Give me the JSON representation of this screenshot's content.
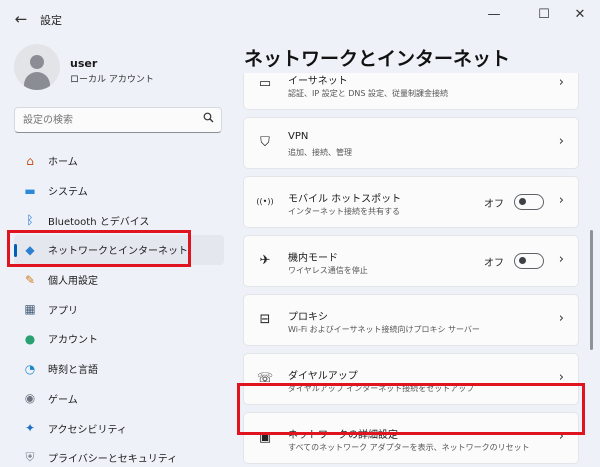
{
  "window": {
    "title": "設定",
    "back_glyph": "←",
    "minimize_glyph": "—",
    "maximize_glyph": "☐",
    "close_glyph": "✕"
  },
  "profile": {
    "name": "user",
    "account_type": "ローカル アカウント"
  },
  "search": {
    "placeholder": "設定の検索",
    "icon": "search-icon"
  },
  "sidebar": {
    "items": [
      {
        "label": "ホーム",
        "icon": "home-icon",
        "glyph": "⌂",
        "color": "#c2551d"
      },
      {
        "label": "システム",
        "icon": "system-icon",
        "glyph": "▬",
        "color": "#2e8ad8"
      },
      {
        "label": "Bluetooth とデバイス",
        "icon": "bluetooth-icon",
        "glyph": "ᛒ",
        "color": "#1d6fd6"
      },
      {
        "label": "ネットワークとインターネット",
        "icon": "wifi-icon",
        "glyph": "◆",
        "color": "#2d7fd2"
      },
      {
        "label": "個人用設定",
        "icon": "brush-icon",
        "glyph": "✎",
        "color": "#d0791e"
      },
      {
        "label": "アプリ",
        "icon": "apps-icon",
        "glyph": "▦",
        "color": "#4a6078"
      },
      {
        "label": "アカウント",
        "icon": "account-icon",
        "glyph": "●",
        "color": "#2aa171"
      },
      {
        "label": "時刻と言語",
        "icon": "globe-clock-icon",
        "glyph": "◔",
        "color": "#1f86c8"
      },
      {
        "label": "ゲーム",
        "icon": "gamepad-icon",
        "glyph": "◉",
        "color": "#6d7480"
      },
      {
        "label": "アクセシビリティ",
        "icon": "accessibility-icon",
        "glyph": "✦",
        "color": "#1f6ec4"
      },
      {
        "label": "プライバシーとセキュリティ",
        "icon": "shield-icon",
        "glyph": "⛨",
        "color": "#7b8591"
      }
    ],
    "active_index": 3
  },
  "main": {
    "page_title": "ネットワークとインターネット",
    "cards": [
      {
        "title": "イーサネット",
        "desc": "認証、IP 設定と DNS 設定、従量制課金接続",
        "icon": "ethernet-icon",
        "glyph": "▭",
        "toggle": null
      },
      {
        "title": "VPN",
        "desc": "追加、接続、管理",
        "icon": "vpn-shield-icon",
        "glyph": "⛉",
        "toggle": null
      },
      {
        "title": "モバイル ホットスポット",
        "desc": "インターネット接続を共有する",
        "icon": "hotspot-icon",
        "glyph": "((•))",
        "toggle": {
          "label": "オフ",
          "on": false
        }
      },
      {
        "title": "機内モード",
        "desc": "ワイヤレス通信を停止",
        "icon": "airplane-icon",
        "glyph": "✈",
        "toggle": {
          "label": "オフ",
          "on": false
        }
      },
      {
        "title": "プロキシ",
        "desc": "Wi-Fi およびイーサネット接続向けプロキシ サーバー",
        "icon": "proxy-icon",
        "glyph": "⊟",
        "toggle": null
      },
      {
        "title": "ダイヤルアップ",
        "desc": "ダイヤルアップ インターネット接続をセットアップ",
        "icon": "dialup-icon",
        "glyph": "☏",
        "toggle": null
      },
      {
        "title": "ネットワークの詳細設定",
        "desc": "すべてのネットワーク アダプターを表示、ネットワークのリセット",
        "icon": "network-adapter-icon",
        "glyph": "▣",
        "toggle": null
      }
    ]
  },
  "highlight_color": "#e0141e",
  "accent_color": "#005fb8"
}
